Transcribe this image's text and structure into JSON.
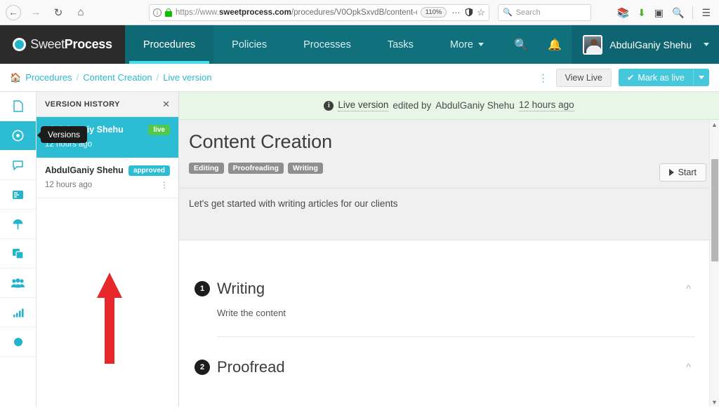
{
  "browser": {
    "back_icon": "back-arrow-icon",
    "forward_icon": "forward-arrow-icon",
    "reload_icon": "reload-icon",
    "home_icon": "home-icon",
    "url": {
      "scheme": "https://www.",
      "domain": "sweetprocess.com",
      "path": "/procedures/V0OpkSxvdB/content-c",
      "tail": "r",
      "full": "https://www.sweetprocess.com/procedures/V0OpkSxvdB/content-c"
    },
    "zoom_level": "110%",
    "page_actions_icon": "ellipsis-icon",
    "tracking_shield_icon": "shield-icon",
    "bookmark_icon": "star-icon",
    "search": {
      "placeholder": "Search",
      "icon": "search-icon"
    },
    "toolbar_icons": [
      "library-icon",
      "downloads-icon",
      "sidebar-icon",
      "page-search-icon",
      "hamburger-menu-icon"
    ]
  },
  "appnav": {
    "logo_light": "Sweet",
    "logo_bold": "Process",
    "tabs": [
      {
        "label": "Procedures",
        "active": true
      },
      {
        "label": "Policies",
        "active": false
      },
      {
        "label": "Processes",
        "active": false
      },
      {
        "label": "Tasks",
        "active": false
      },
      {
        "label": "More",
        "active": false,
        "has_caret": true
      }
    ],
    "search_icon": "search-icon",
    "bell_icon": "notification-bell-icon",
    "user_name": "AbdulGaniy Shehu",
    "user_caret_icon": "chevron-down-icon",
    "colors": {
      "navbar": "#10707c",
      "logo_block": "#2b2b2b",
      "active_underline": "#41e0f0"
    }
  },
  "breadcrumb": {
    "home_icon": "home-icon",
    "items": [
      "Procedures",
      "Content Creation",
      "Live version"
    ],
    "separator": "/",
    "kebab_icon": "vertical-ellipsis-icon",
    "view_live_label": "View Live",
    "mark_live_label": "Mark as live",
    "mark_live_check": "✔",
    "mark_live_caret_icon": "chevron-down-icon"
  },
  "rail": {
    "items": [
      {
        "name": "document",
        "glyph": "🗋",
        "active": false
      },
      {
        "name": "version-history",
        "glyph": "◉",
        "active": true
      },
      {
        "name": "comments",
        "glyph": "💬",
        "active": false
      },
      {
        "name": "activity-log",
        "glyph": "≣",
        "active": false
      },
      {
        "name": "publish",
        "glyph": "☂",
        "active": false
      },
      {
        "name": "duplicate",
        "glyph": "❐",
        "active": false
      },
      {
        "name": "teams",
        "glyph": "👥",
        "active": false
      },
      {
        "name": "analytics",
        "glyph": "📊",
        "active": false
      },
      {
        "name": "status",
        "glyph": "●",
        "active": false
      }
    ]
  },
  "version_panel": {
    "title": "VERSION HISTORY",
    "close_icon": "close-icon",
    "rows": [
      {
        "author": "AbdulGaniy Shehu",
        "time": "12 hours ago",
        "badge": "live",
        "selected": true
      },
      {
        "author": "AbdulGaniy Shehu",
        "time": "12 hours ago",
        "badge": "approved",
        "selected": false,
        "kebab_icon": "vertical-ellipsis-icon"
      }
    ],
    "tooltip": "Versions",
    "annotation_arrow": {
      "name": "red-annotation-arrow",
      "color": "#e8272b",
      "direction": "up"
    }
  },
  "content": {
    "banner": {
      "info_icon": "info-icon",
      "label": "Live version",
      "mid": "edited by",
      "author": "AbdulGaniy Shehu",
      "time": "12 hours ago"
    },
    "title": "Content Creation",
    "tags": [
      "Editing",
      "Proofreading",
      "Writing"
    ],
    "start_label": "Start",
    "start_icon": "play-icon",
    "intro": "Let's get started with writing articles for our clients",
    "steps": [
      {
        "number": "1",
        "title": "Writing",
        "body": "Write the content",
        "collapse_icon": "chevron-up-icon"
      },
      {
        "number": "2",
        "title": "Proofread",
        "body": "",
        "collapse_icon": "chevron-up-icon"
      }
    ],
    "scrollbar": {
      "up_icon": "chevron-up-icon",
      "down_icon": "chevron-down-icon"
    }
  }
}
